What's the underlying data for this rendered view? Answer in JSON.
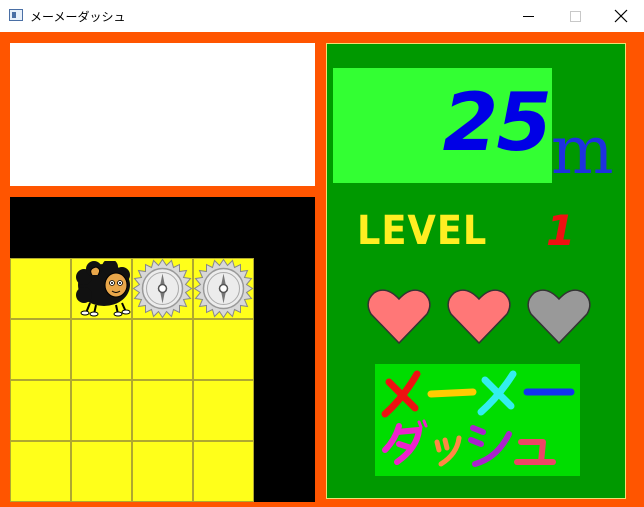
{
  "window": {
    "title": "メーメーダッシュ",
    "controls": {
      "minimize": "minimize",
      "maximize": "maximize",
      "close": "close"
    }
  },
  "game": {
    "distance": "25",
    "distance_unit": "m",
    "level_label": "LEVEL",
    "level_value": "1",
    "lives_total": 3,
    "lives_remaining": 2,
    "logo_text": "メーメーダッシュ",
    "message": ""
  },
  "colors": {
    "frame": "#ff5500",
    "panel": "#009900",
    "distance_box": "#33ff33",
    "distance_text": "#0000e6",
    "level_label": "#ffee22",
    "level_value": "#ee1111",
    "heart_full": "#ff7777",
    "heart_empty": "#999999",
    "tile": "#ffff1a"
  },
  "board": {
    "player": "black-sheep",
    "obstacles": [
      "saw-blade",
      "saw-blade"
    ]
  }
}
